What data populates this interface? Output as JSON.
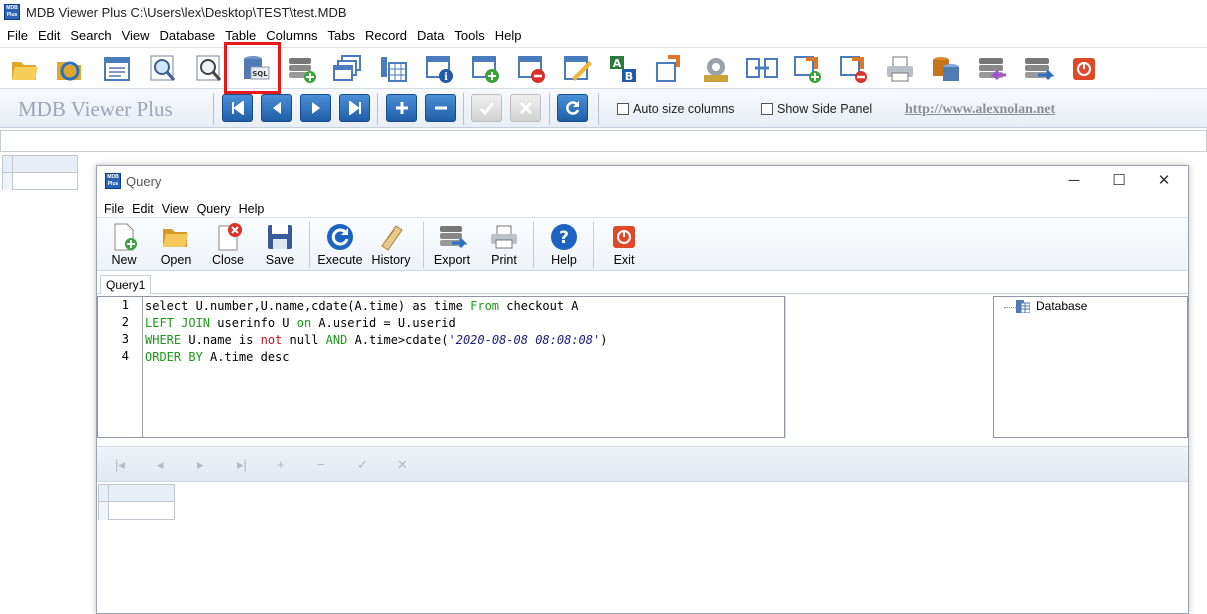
{
  "window": {
    "title": "MDB Viewer Plus C:\\Users\\lex\\Desktop\\TEST\\test.MDB",
    "icon_text": "MDB Plus"
  },
  "menu": [
    "File",
    "Edit",
    "Search",
    "View",
    "Database",
    "Table",
    "Columns",
    "Tabs",
    "Record",
    "Data",
    "Tools",
    "Help"
  ],
  "toolbar_icons": [
    "open-folder-icon",
    "refresh-db-icon",
    "table-list-icon",
    "search-icon",
    "zoom-icon",
    "sql-query-icon",
    "add-table-icon",
    "tables-icon",
    "columns-icon",
    "table-info-icon",
    "add-row-icon",
    "delete-row-icon",
    "edit-table-icon",
    "sort-ab-icon",
    "export-table-icon",
    "settings-icon",
    "link-tables-icon",
    "import-icon",
    "relations-icon",
    "print-icon",
    "compact-db-icon",
    "db-import-icon",
    "db-export-icon",
    "exit-icon"
  ],
  "brand": "MDB Viewer Plus",
  "nav": {
    "auto_size_label": "Auto size columns",
    "side_panel_label": "Show Side Panel",
    "website": "http://www.alexnolan.net"
  },
  "colors": {
    "accent": "#1f5fa8",
    "highlight": "#e81818",
    "keyword": "#1a9a1a"
  },
  "query": {
    "title": "Query",
    "menu": [
      "File",
      "Edit",
      "View",
      "Query",
      "Help"
    ],
    "buttons": [
      "New",
      "Open",
      "Close",
      "Save",
      "Execute",
      "History",
      "Export",
      "Print",
      "Help",
      "Exit"
    ],
    "tab": "Query1",
    "line_numbers": [
      "1",
      "2",
      "3",
      "4"
    ],
    "sql": [
      [
        [
          "select",
          ""
        ],
        [
          " U.number,U.name,cdate(A.time) as time ",
          ""
        ],
        [
          "From",
          "kw"
        ],
        [
          " checkout A",
          ""
        ]
      ],
      [
        [
          "LEFT JOIN",
          "kw"
        ],
        [
          " userinfo U ",
          ""
        ],
        [
          "on",
          "kw"
        ],
        [
          " A.userid = U.userid",
          ""
        ]
      ],
      [
        [
          "WHERE",
          "kw"
        ],
        [
          " U.name is ",
          ""
        ],
        [
          "not",
          "nu"
        ],
        [
          " null ",
          ""
        ],
        [
          "AND",
          "kw"
        ],
        [
          " A.time>cdate(",
          ""
        ],
        [
          "'2020-08-08 08:08:08'",
          "str"
        ],
        [
          ")",
          ""
        ]
      ],
      [
        [
          "ORDER BY",
          "kw"
        ],
        [
          " A.time desc",
          ""
        ]
      ]
    ],
    "side_panel_root": "Database",
    "result_nav": [
      "|◂",
      "◂",
      "▸",
      "▸|",
      "+",
      "−",
      "✓",
      "✕"
    ]
  }
}
